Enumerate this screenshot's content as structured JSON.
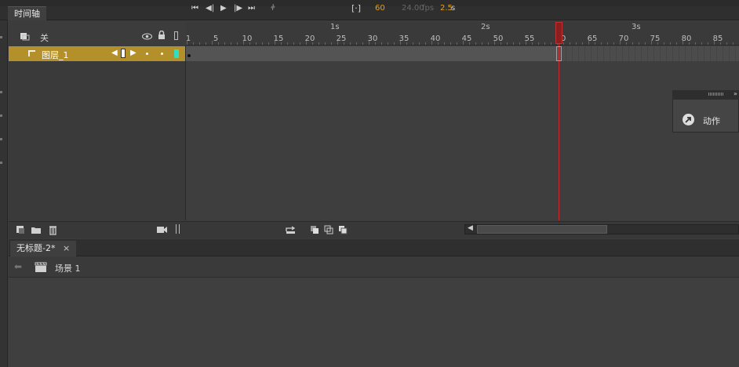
{
  "timeline_tab": {
    "label": "时间轴"
  },
  "layer_header": {
    "label": "关"
  },
  "layer": {
    "name": "图层_1"
  },
  "ruler": {
    "seconds": [
      "1s",
      "2s",
      "3s"
    ],
    "ticks": [
      "1",
      "5",
      "10",
      "15",
      "20",
      "25",
      "30",
      "35",
      "40",
      "45",
      "50",
      "55",
      "60",
      "65",
      "70",
      "75",
      "80",
      "85"
    ]
  },
  "playback": {
    "frame": "60",
    "fps": "24.00",
    "fps_unit": "fps",
    "time": "2.5",
    "time_unit": "s"
  },
  "document": {
    "tab_label": "无标题-2*",
    "close": "×",
    "scene_label": "场景 1"
  },
  "action_panel": {
    "label": "动作"
  },
  "colors": {
    "layer_highlight": "#b4902a",
    "playhead": "#c82a2a",
    "accent_orange": "#e0a020",
    "layer_color_box": "#2ee0c0"
  }
}
